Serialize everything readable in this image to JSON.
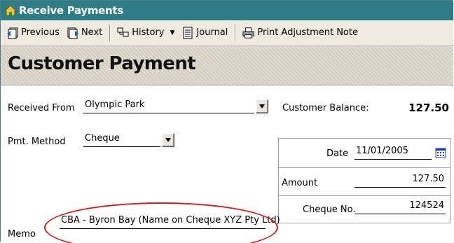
{
  "window": {
    "title": "Receive Payments"
  },
  "toolbar": {
    "previous": "Previous",
    "next": "Next",
    "history": "History",
    "journal": "Journal",
    "print_adjustment_note": "Print Adjustment Note"
  },
  "page_title": "Customer Payment",
  "form": {
    "received_from_label": "Received From",
    "received_from_value": "Olympic Park",
    "pmt_method_label": "Pmt. Method",
    "pmt_method_value": "Cheque",
    "memo_label": "Memo",
    "memo_value": "CBA - Byron Bay (Name on Cheque XYZ Pty Ltd)",
    "customer_balance_label": "Customer Balance:",
    "customer_balance_value": "127.50",
    "date_label": "Date",
    "date_value": "11/01/2005",
    "amount_label": "Amount",
    "amount_value": "127.50",
    "cheque_no_label": "Cheque No.",
    "cheque_no_value": "124524"
  },
  "colors": {
    "titlebar": "#2e7d86",
    "annotation": "#d11b1b"
  }
}
